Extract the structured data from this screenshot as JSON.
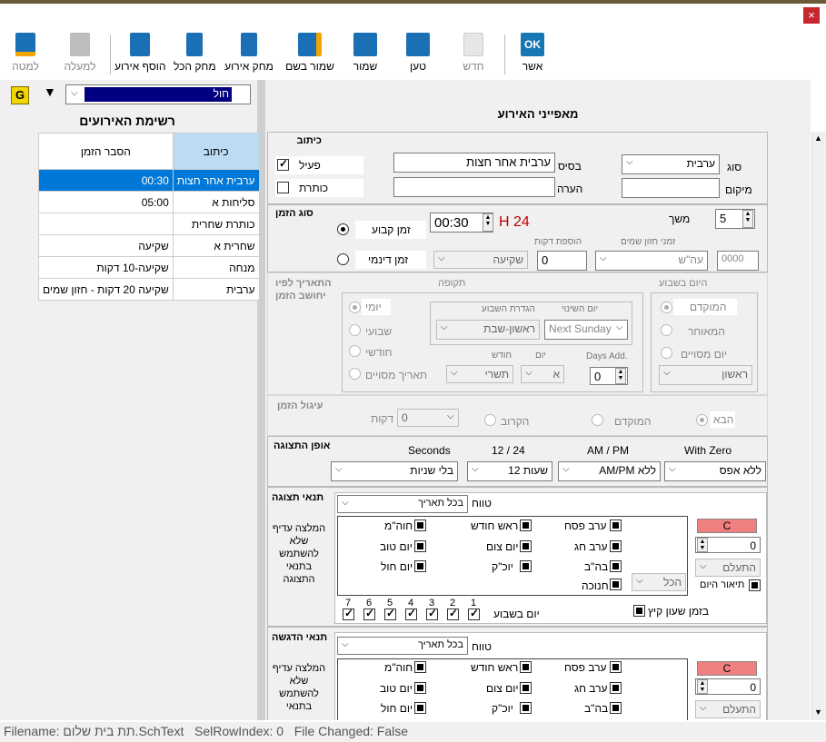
{
  "window": {
    "close": "×"
  },
  "toolbar": {
    "ok": "אשר",
    "new": "חדש",
    "load": "טען",
    "save": "שמור",
    "save_as": "שמור בשם",
    "delete_event": "מחק אירוע",
    "delete_all": "מחק הכל",
    "add_event": "הוסף אירוע",
    "up": "למעלה",
    "down": "למטה"
  },
  "filter": {
    "g_label": "G",
    "value": "חול"
  },
  "event_list": {
    "title": "רשימת האירועים",
    "columns": [
      "כיתוב",
      "הסבר הזמן"
    ],
    "rows": [
      {
        "caption": "ערבית אחר חצות",
        "time": "00:30",
        "selected": true
      },
      {
        "caption": "סליחות א",
        "time": "05:00"
      },
      {
        "caption": "כותרת שחרית",
        "time": ""
      },
      {
        "caption": "שחרית א",
        "time": "שקיעה"
      },
      {
        "caption": "מנחה",
        "time": "שקיעה-10 דקות"
      },
      {
        "caption": "ערבית",
        "time": "שקיעה 20 דקות - חזון שמים"
      }
    ]
  },
  "props": {
    "title": "מאפייני האירוע",
    "caption": {
      "title": "כיתוב",
      "type_label": "סוג",
      "type_value": "ערבית",
      "base_label": "בסיס",
      "base_value": "ערבית אחר חצות",
      "location_label": "מיקום",
      "note_label": "הערה",
      "active_label": "פעיל",
      "heading_label": "כותרת"
    },
    "time_type": {
      "title": "סוג הזמן",
      "fixed_label": "זמן קבוע",
      "dynamic_label": "זמן דינמי",
      "time_value": "00:30",
      "hour_format": "24 H",
      "duration_label": "משך",
      "duration_value": "5",
      "chazon_label": "זמני חזון שמים",
      "chazon_value": "עה\"ש",
      "chazon_num": "0000",
      "add_minutes_label": "הוספת דקות",
      "add_minutes_value": "0",
      "sunset_value": "שקיעה"
    },
    "date_calc": {
      "title_1": "התאריך לפיו",
      "title_2": "יחושב הזמן",
      "weekday_title": "היום בשבוע",
      "earlier": "המוקדם",
      "later": "המאוחר",
      "specific_day": "יום מסויים",
      "specific_day_value": "ראשון",
      "period_title": "תקופה",
      "change_day_label": "יום השינוי",
      "change_day_value": "Next Sunday",
      "week_def_label": "הגדרת השבוע",
      "week_def_value": "ראשון-שבת",
      "days_add_label": "Days Add.",
      "days_add_value": "0",
      "day_label": "יום",
      "day_value": "א",
      "month_label": "חודש",
      "month_value": "תשרי",
      "daily": "יומי",
      "weekly": "שבועי",
      "monthly": "חודשי",
      "specific_date": "תאריך מסויים"
    },
    "rounding": {
      "title": "עיגול הזמן",
      "next": "הבא",
      "earlier": "המוקדם",
      "nearest": "הקרוב",
      "minutes_label": "דקות",
      "minutes_value": "0"
    },
    "display": {
      "title": "אופן התצוגה",
      "with_zero_label": "With Zero",
      "with_zero_value": "ללא אפס",
      "ampm_label": "AM / PM",
      "ampm_value": "ללא AM/PM",
      "h1224_label": "12 / 24",
      "h1224_value": "שעות 12",
      "seconds_label": "Seconds",
      "seconds_value": "בלי שניות"
    },
    "show_cond": {
      "title": "תנאי תצוגה",
      "range_label": "טווח",
      "range_value": "בכל תאריך",
      "recommend": "המלצה עדיף שלא להשתמש בתנאי התצוגה",
      "c_label": "C",
      "spin_value": "0",
      "ignore_label": "התעלם",
      "day_desc_label": "תיאור היום",
      "all_label": "הכל",
      "erev_pesach": "ערב פסח",
      "rosh_chodesh": "ראש חודש",
      "chol_hamoed": "חוה\"מ",
      "erev_chag": "ערב חג",
      "yom_tzom": "יום צום",
      "yom_tov": "יום טוב",
      "bahab": "בה\"ב",
      "yom_kippur": "יוכ\"ק",
      "yom_chol": "יום חול",
      "chanukah": "חנוכה",
      "summer_time": "בזמן שעון קיץ",
      "weekday_label": "יום בשבוע",
      "days": [
        "1",
        "2",
        "3",
        "4",
        "5",
        "6",
        "7"
      ]
    },
    "hl_cond": {
      "title": "תנאי הדגשה",
      "range_label": "טווח",
      "range_value": "בכל תאריך",
      "recommend": "המלצה עדיף שלא להשתמש בתנאי",
      "c_label": "C",
      "spin_value": "0",
      "ignore_label": "התעלם",
      "erev_pesach": "ערב פסח",
      "rosh_chodesh": "ראש חודש",
      "chol_hamoed": "חוה\"מ",
      "erev_chag": "ערב חג",
      "yom_tzom": "יום צום",
      "yom_tov": "יום טוב",
      "bahab": "בה\"ב",
      "yom_kippur": "יוכ\"ק",
      "yom_chol": "יום חול"
    }
  },
  "status": {
    "text": "Filename: תת בית שלום.SchText   SelRowIndex: 0   File Changed: False"
  },
  "colors": {
    "accent": "#0078d7",
    "toolbar_icon": "#1a6fb5",
    "ok_icon": "#1677b3",
    "time_red": "#c00000"
  }
}
